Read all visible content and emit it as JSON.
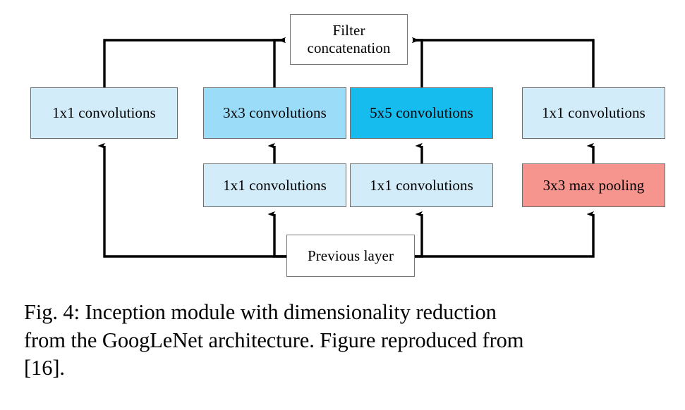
{
  "figure": {
    "nodes": [
      {
        "id": "filter-concat",
        "label": "Filter concatenation",
        "color": "#ffffff"
      },
      {
        "id": "conv1x1-left",
        "label": "1x1 convolutions",
        "color": "#d3ecfa"
      },
      {
        "id": "conv3x3",
        "label": "3x3 convolutions",
        "color": "#9bdcf8"
      },
      {
        "id": "conv5x5",
        "label": "5x5 convolutions",
        "color": "#16bcee"
      },
      {
        "id": "conv1x1-right",
        "label": "1x1 convolutions",
        "color": "#d3ecfa"
      },
      {
        "id": "conv1x1-mid1",
        "label": "1x1 convolutions",
        "color": "#d3ecfa"
      },
      {
        "id": "conv1x1-mid2",
        "label": "1x1 convolutions",
        "color": "#d3ecfa"
      },
      {
        "id": "maxpool",
        "label": "3x3 max pooling",
        "color": "#f6948e"
      },
      {
        "id": "previous-layer",
        "label": "Previous layer",
        "color": "#ffffff"
      }
    ],
    "labels": {
      "filter_concat_line1": "Filter",
      "filter_concat_line2": "concatenation",
      "conv1x1_left": "1x1 convolutions",
      "conv3x3": "3x3 convolutions",
      "conv5x5": "5x5 convolutions",
      "conv1x1_right": "1x1 convolutions",
      "conv1x1_mid1": "1x1 convolutions",
      "conv1x1_mid2": "1x1 convolutions",
      "maxpool": "3x3 max pooling",
      "previous_layer": "Previous layer"
    },
    "colors": {
      "pale_blue": "#d3ecfa",
      "mid_blue": "#9bdcf8",
      "strong_cyan": "#16bcee",
      "salmon": "#f6948e",
      "white": "#ffffff",
      "box_border": "#6e6e6e",
      "arrow": "#000000"
    },
    "edges": [
      {
        "from": "previous-layer",
        "to": "conv1x1-left",
        "style": "elbow-left"
      },
      {
        "from": "previous-layer",
        "to": "conv1x1-mid1",
        "style": "elbow"
      },
      {
        "from": "previous-layer",
        "to": "conv1x1-mid2",
        "style": "elbow"
      },
      {
        "from": "previous-layer",
        "to": "maxpool",
        "style": "elbow-right"
      },
      {
        "from": "conv1x1-mid1",
        "to": "conv3x3",
        "style": "straight"
      },
      {
        "from": "conv1x1-mid2",
        "to": "conv5x5",
        "style": "straight"
      },
      {
        "from": "maxpool",
        "to": "conv1x1-right",
        "style": "straight"
      },
      {
        "from": "conv1x1-left",
        "to": "filter-concat",
        "style": "elbow-left"
      },
      {
        "from": "conv3x3",
        "to": "filter-concat",
        "style": "elbow"
      },
      {
        "from": "conv5x5",
        "to": "filter-concat",
        "style": "elbow"
      },
      {
        "from": "conv1x1-right",
        "to": "filter-concat",
        "style": "elbow-right"
      }
    ]
  },
  "caption": {
    "line1": "Fig. 4: Inception module with dimensionality reduction",
    "line2": "from the GoogLeNet architecture. Figure reproduced from",
    "line3": "[16]."
  }
}
